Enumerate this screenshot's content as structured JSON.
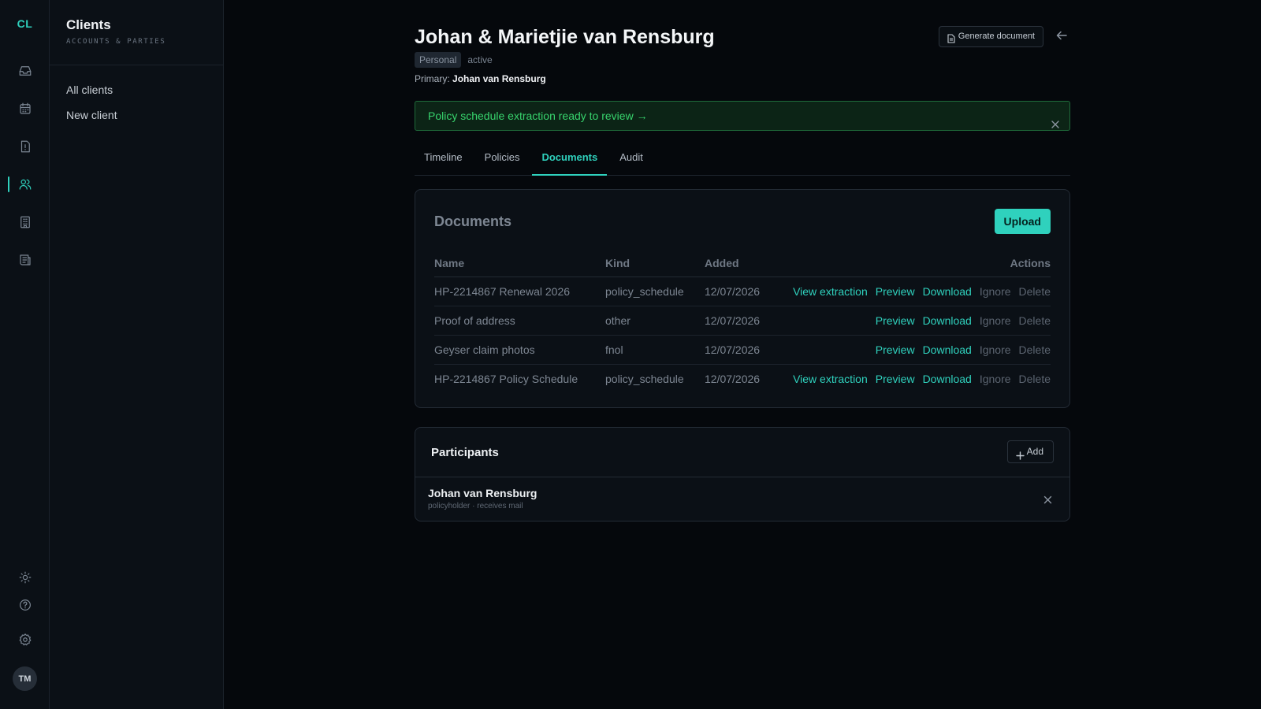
{
  "rail": {
    "logo": "CL",
    "icons": [
      "inbox-icon",
      "calendar-icon",
      "alert-icon",
      "users-icon",
      "building-icon",
      "ledger-icon"
    ],
    "bottom_icons": [
      "sun-icon",
      "help-icon",
      "settings-icon"
    ],
    "avatar": "TM",
    "accent": "#2fd1bd"
  },
  "sidebar": {
    "title": "Clients",
    "subtitle": "ACCOUNTS & PARTIES",
    "items": [
      {
        "label": "All clients"
      },
      {
        "label": "New client"
      }
    ]
  },
  "header": {
    "name": "Johan & Marietjie van Rensburg",
    "type_badge": "Personal",
    "status": "active",
    "primary_label": "Primary:",
    "primary_name": "Johan van Rensburg",
    "generate_label": "Generate document"
  },
  "banner": {
    "text": "Policy schedule extraction ready to review →",
    "color": "#37d46d"
  },
  "tabs": [
    {
      "label": "Timeline",
      "active": false
    },
    {
      "label": "Policies",
      "active": false
    },
    {
      "label": "Documents",
      "active": true
    },
    {
      "label": "Audit",
      "active": false
    }
  ],
  "documents": {
    "title": "Documents",
    "upload_label": "Upload",
    "columns": [
      "Name",
      "Kind",
      "Added",
      "Actions"
    ],
    "action_labels": {
      "view_extraction": "View extraction",
      "preview": "Preview",
      "download": "Download",
      "ignore": "Ignore",
      "delete": "Delete"
    },
    "rows": [
      {
        "name": "HP-2214867 Renewal 2026",
        "kind": "policy_schedule",
        "added": "12/07/2026",
        "has_extraction": true
      },
      {
        "name": "Proof of address",
        "kind": "other",
        "added": "12/07/2026",
        "has_extraction": false
      },
      {
        "name": "Geyser claim photos",
        "kind": "fnol",
        "added": "12/07/2026",
        "has_extraction": false
      },
      {
        "name": "HP-2214867 Policy Schedule",
        "kind": "policy_schedule",
        "added": "12/07/2026",
        "has_extraction": true
      }
    ]
  },
  "participants": {
    "title": "Participants",
    "add_label": "Add",
    "items": [
      {
        "name": "Johan van Rensburg",
        "meta": "policyholder · receives mail"
      }
    ]
  }
}
